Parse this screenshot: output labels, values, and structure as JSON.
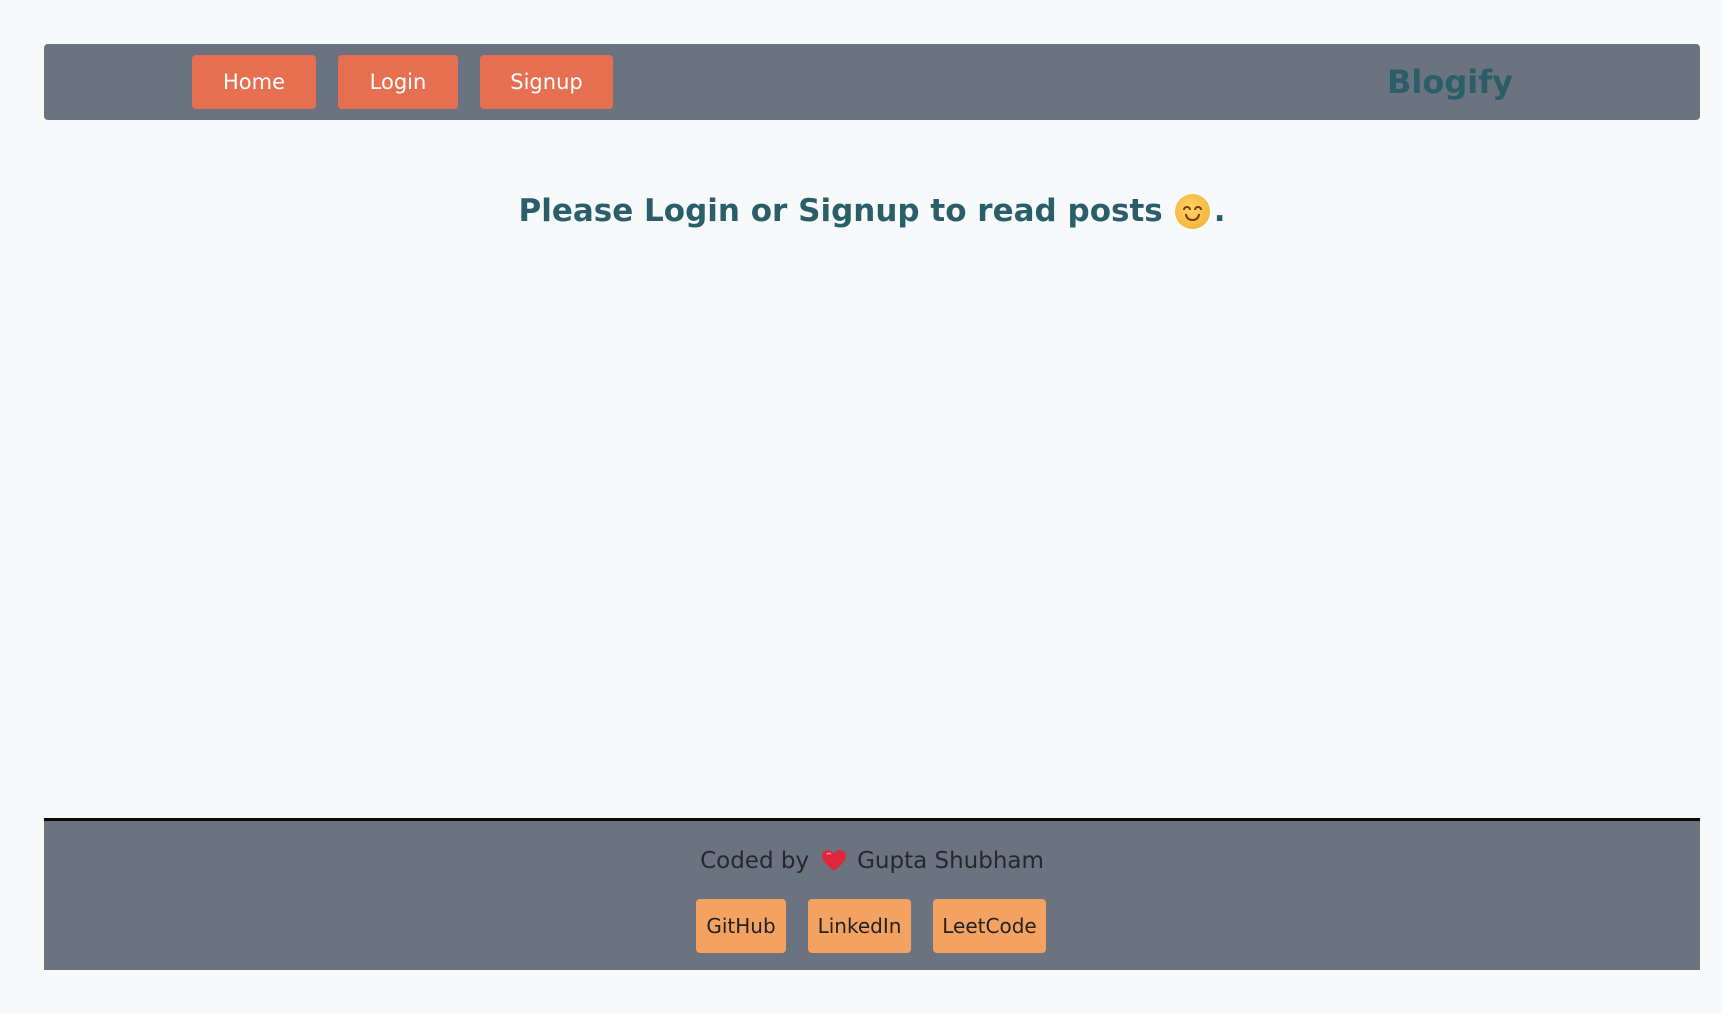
{
  "navbar": {
    "buttons": [
      "Home",
      "Login",
      "Signup"
    ],
    "brand": "Blogify"
  },
  "main": {
    "message_prefix": "Please Login or Signup to read posts",
    "message_suffix": ".",
    "emoji_icon": "smiling-face-icon"
  },
  "footer": {
    "credit_prefix": "Coded by",
    "heart_icon": "heart-icon",
    "author": "Gupta Shubham",
    "links": [
      "GitHub",
      "LinkedIn",
      "LeetCode"
    ]
  },
  "colors": {
    "page_background": "#f8f9fb",
    "bar_background": "#6b7280",
    "nav_button": "#e76f51",
    "footer_button": "#f4a261",
    "brand_text": "#2a5f69"
  }
}
